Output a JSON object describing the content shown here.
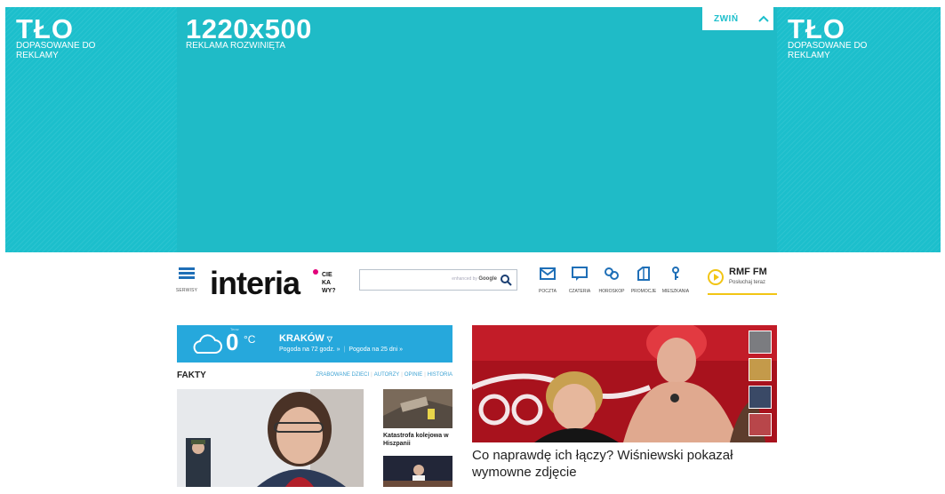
{
  "ad": {
    "left_title": "TŁO",
    "left_subtitle": "DOPASOWANE DO REKLAMY",
    "center_size": "1220x500",
    "center_desc": "REKLAMA ROZWINIĘTA",
    "collapse_label": "ZWIŃ",
    "right_title": "TŁO",
    "right_subtitle": "DOPASOWANE DO REKLAMY"
  },
  "header": {
    "menu_label": "SERWISY",
    "logo_text": "interia",
    "logo_tag": "CIE KA WY?",
    "search_brand_prefix": "enhanced by",
    "search_brand": "Google",
    "services": [
      {
        "label": "POCZTA",
        "icon": "mail-icon"
      },
      {
        "label": "CZATERIA",
        "icon": "chat-icon"
      },
      {
        "label": "HOROSKOP",
        "icon": "horoscope-icon"
      },
      {
        "label": "PROMOCJE",
        "icon": "promo-icon"
      },
      {
        "label": "MIESZKANIA",
        "icon": "key-icon"
      }
    ],
    "radio_name": "RMF FM",
    "radio_sub": "Posłuchaj teraz"
  },
  "weather": {
    "temp_label": "Teraz",
    "temperature": "0",
    "unit": "°C",
    "city": "KRAKÓW",
    "link_72h": "Pogoda na 72 godz. »",
    "link_25d": "Pogoda na 25 dni »"
  },
  "facts": {
    "title": "FAKTY",
    "tabs": [
      "ZRABOWANE DZIECI",
      "AUTORZY",
      "OPINIE",
      "HISTORIA"
    ],
    "side_caption": "Katastrofa kolejowa w Hiszpanii"
  },
  "hero": {
    "title": "Co naprawdę ich łączy? Wiśniewski pokazał wymowne zdjęcie"
  },
  "colors": {
    "ad_teal": "#1fbbc7",
    "weather_blue": "#26a8dc",
    "logo_pink": "#e2007a",
    "radio_yellow": "#f2c515"
  }
}
